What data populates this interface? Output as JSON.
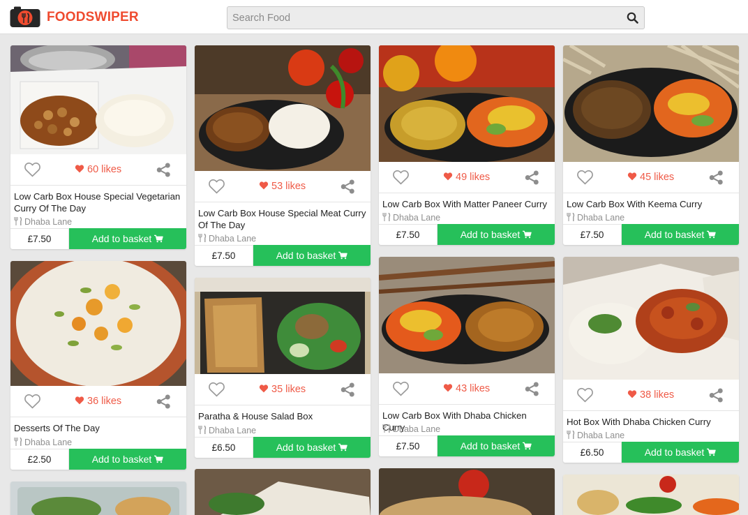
{
  "app": {
    "brand": "FOODSWIPER",
    "search_placeholder": "Search Food"
  },
  "colors": {
    "brand": "#ef4b2f",
    "likes": "#ef5a47",
    "basket_button": "#26c05a"
  },
  "icons": [
    "camera-logo-icon",
    "search-icon",
    "heart-outline-icon",
    "heart-filled-icon",
    "share-icon",
    "fork-knife-icon",
    "cart-icon"
  ],
  "basket_label": "Add to basket",
  "cards": [
    {
      "likes": "60 likes",
      "name": "Low Carb Box House Special Vegetarian Curry Of The Day",
      "restaurant": "Dhaba Lane",
      "price": "£7.50",
      "photo": "curry box with chickpeas and rice"
    },
    {
      "likes": "53 likes",
      "name": "Low Carb Box House Special Meat Curry Of The Day",
      "restaurant": "Dhaba Lane",
      "price": "£7.50",
      "photo": "meat curry with rice, peppers"
    },
    {
      "likes": "49 likes",
      "name": "Low Carb Box With Matter Paneer Curry",
      "restaurant": "Dhaba Lane",
      "price": "£7.50",
      "photo": "paneer curry with salad"
    },
    {
      "likes": "45 likes",
      "name": "Low Carb Box With Keema Curry",
      "restaurant": "Dhaba Lane",
      "price": "£7.50",
      "photo": "keema curry with salad"
    },
    {
      "likes": "36 likes",
      "name": "Desserts Of The Day",
      "restaurant": "Dhaba Lane",
      "price": "£2.50",
      "photo": "rice pudding with apricots and pistachios"
    },
    {
      "likes": "35 likes",
      "name": "Paratha & House Salad Box",
      "restaurant": "Dhaba Lane",
      "price": "£6.50",
      "photo": "paratha and salad box"
    },
    {
      "likes": "43 likes",
      "name": "Low Carb Box With Dhaba Chicken Curry",
      "restaurant": "Dhaba Lane",
      "price": "£7.50",
      "photo": "chicken curry with salad"
    },
    {
      "likes": "38 likes",
      "name": "Hot Box With Dhaba Chicken Curry",
      "restaurant": "Dhaba Lane",
      "price": "£6.50",
      "photo": "chicken curry with rice in box"
    }
  ]
}
